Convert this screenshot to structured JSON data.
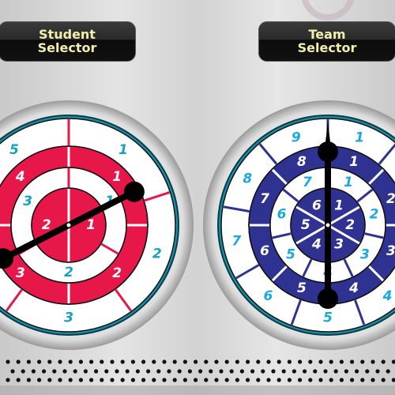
{
  "student_selector": {
    "label_line1": "Student",
    "label_line2": "Selector",
    "hand_angle_deg": 63,
    "rings": [
      {
        "labels": [
          "1",
          "2",
          "3",
          "4",
          "5"
        ],
        "fill": "#ffffff",
        "text_color": "#1a9fc4",
        "line_color": "#e8174a"
      },
      {
        "labels": [
          "1",
          "2",
          "3",
          "4"
        ],
        "fill": "#e8174a",
        "text_color": "#ffffff",
        "line_color": "#ffffff"
      },
      {
        "labels": [
          "1",
          "2",
          "3"
        ],
        "fill": "#ffffff",
        "text_color": "#1a9fc4",
        "line_color": "#e8174a"
      },
      {
        "labels": [
          "1",
          "2"
        ],
        "fill": "#e8174a",
        "text_color": "#ffffff",
        "line_color": "#ffffff"
      }
    ]
  },
  "team_selector": {
    "label_line1": "Team",
    "label_line2": "Selector",
    "hand_angle_deg": 0,
    "rings": [
      {
        "labels": [
          "1",
          "2",
          "3",
          "4",
          "5",
          "6",
          "7",
          "8",
          "9"
        ],
        "fill": "#ffffff",
        "text_color": "#19a8e0",
        "line_color": "#2f3290"
      },
      {
        "labels": [
          "1",
          "2",
          "3",
          "4",
          "5",
          "6",
          "7",
          "8"
        ],
        "fill": "#2f3290",
        "text_color": "#ffffff",
        "line_color": "#ffffff"
      },
      {
        "labels": [
          "1",
          "2",
          "3",
          "4",
          "5",
          "6",
          "7"
        ],
        "fill": "#ffffff",
        "text_color": "#19a8e0",
        "line_color": "#2f3290"
      },
      {
        "labels": [
          "1",
          "2",
          "3",
          "4",
          "5",
          "6"
        ],
        "fill": "#2f3290",
        "text_color": "#ffffff",
        "line_color": "#ffffff"
      }
    ]
  },
  "colors": {
    "bezel_ring": "#1a8fa8",
    "button_text": "#f1eeae",
    "hand": "#000000"
  }
}
